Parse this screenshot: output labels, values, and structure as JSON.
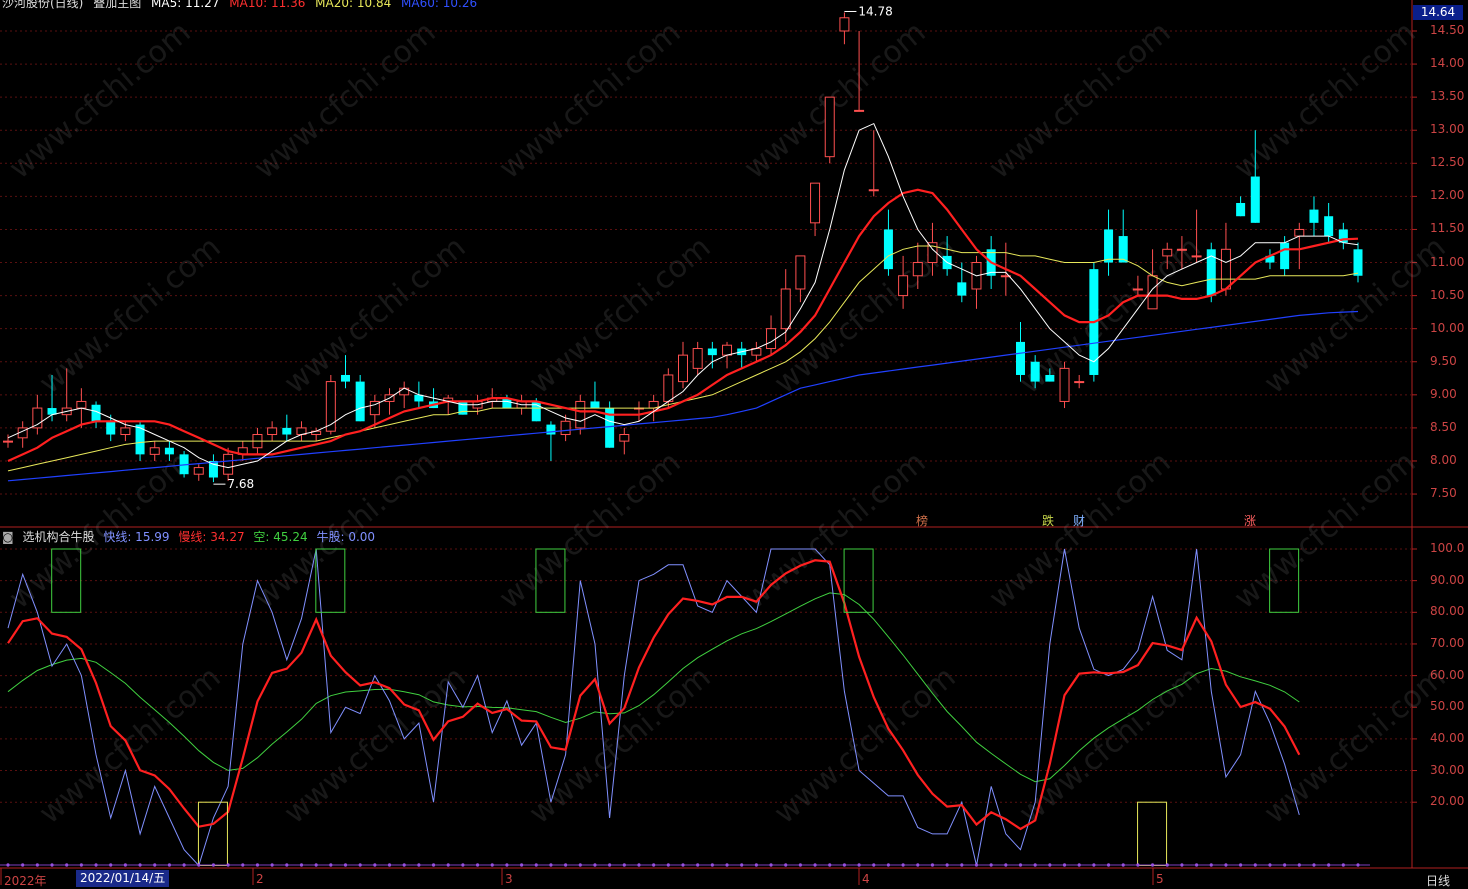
{
  "header": {
    "stock_name": "沙河股份(日线)",
    "indicator": "叠加主图",
    "ma5": "MA5: 11.27",
    "ma10": "MA10: 11.36",
    "ma20": "MA20: 10.84",
    "ma60": "MA60: 10.26"
  },
  "current_price": "14.64",
  "price_axis": [
    "14.50",
    "14.00",
    "13.50",
    "13.00",
    "12.50",
    "12.00",
    "11.50",
    "11.00",
    "10.50",
    "10.00",
    "9.50",
    "9.00",
    "8.50",
    "8.00",
    "7.50"
  ],
  "high_label": "14.78",
  "low_label": "7.68",
  "events": [
    {
      "text": "榜",
      "color": "#d0704a"
    },
    {
      "text": "跌",
      "color": "#c8d84a"
    },
    {
      "text": "财",
      "color": "#7fb0ff"
    },
    {
      "text": "涨",
      "color": "#ff6060"
    }
  ],
  "indicator_panel": {
    "title": "选机构合牛股",
    "fast": "快线: 15.99",
    "slow": "慢线: 34.27",
    "empty": "空: 45.24",
    "bull": "牛股: 0.00",
    "axis": [
      "100.0",
      "90.00",
      "80.00",
      "70.00",
      "60.00",
      "50.00",
      "40.00",
      "30.00",
      "20.00"
    ]
  },
  "time_axis": [
    "2022年",
    "2",
    "3",
    "4",
    "5"
  ],
  "cursor_date": "2022/01/14/五",
  "period": "日线",
  "watermark": "www.cfchi.com",
  "colors": {
    "up": "#ff5050",
    "down": "#00ffff",
    "ma5": "#ffffff",
    "ma10": "#ff2020",
    "ma20": "#e8e85a",
    "ma60": "#2040ff",
    "fast": "#8090ff",
    "slow": "#ff2020",
    "empty": "#40d040"
  },
  "chart_data": {
    "type": "candlestick",
    "candles": [
      [
        8.3,
        8.4,
        8.2,
        8.3
      ],
      [
        8.35,
        8.6,
        8.2,
        8.5
      ],
      [
        8.5,
        9.0,
        8.4,
        8.8
      ],
      [
        8.8,
        9.3,
        8.6,
        8.7
      ],
      [
        8.7,
        9.4,
        8.6,
        8.8
      ],
      [
        8.8,
        9.1,
        8.5,
        8.9
      ],
      [
        8.85,
        8.9,
        8.5,
        8.6
      ],
      [
        8.6,
        8.7,
        8.3,
        8.4
      ],
      [
        8.4,
        8.6,
        8.3,
        8.5
      ],
      [
        8.55,
        8.6,
        8.0,
        8.1
      ],
      [
        8.1,
        8.3,
        8.0,
        8.2
      ],
      [
        8.2,
        8.3,
        8.0,
        8.1
      ],
      [
        8.1,
        8.15,
        7.75,
        7.8
      ],
      [
        7.8,
        7.95,
        7.7,
        7.9
      ],
      [
        8.0,
        8.1,
        7.68,
        7.75
      ],
      [
        7.8,
        8.2,
        7.7,
        8.1
      ],
      [
        8.1,
        8.3,
        8.0,
        8.2
      ],
      [
        8.2,
        8.5,
        8.1,
        8.4
      ],
      [
        8.4,
        8.6,
        8.3,
        8.5
      ],
      [
        8.5,
        8.7,
        8.3,
        8.4
      ],
      [
        8.4,
        8.6,
        8.3,
        8.5
      ],
      [
        8.4,
        8.5,
        8.3,
        8.45
      ],
      [
        8.45,
        9.3,
        8.4,
        9.2
      ],
      [
        9.3,
        9.6,
        9.1,
        9.2
      ],
      [
        9.2,
        9.3,
        8.6,
        8.6
      ],
      [
        8.7,
        9.0,
        8.5,
        8.9
      ],
      [
        8.9,
        9.1,
        8.7,
        9.0
      ],
      [
        9.0,
        9.2,
        8.8,
        9.1
      ],
      [
        9.0,
        9.2,
        8.8,
        8.9
      ],
      [
        8.9,
        9.1,
        8.8,
        8.8
      ],
      [
        8.9,
        9.0,
        8.7,
        8.95
      ],
      [
        8.9,
        8.9,
        8.7,
        8.7
      ],
      [
        8.8,
        9.0,
        8.7,
        8.9
      ],
      [
        8.9,
        9.1,
        8.8,
        8.95
      ],
      [
        8.95,
        9.0,
        8.8,
        8.8
      ],
      [
        8.8,
        9.0,
        8.7,
        8.9
      ],
      [
        8.9,
        8.95,
        8.6,
        8.6
      ],
      [
        8.55,
        8.6,
        8.0,
        8.4
      ],
      [
        8.4,
        8.7,
        8.3,
        8.6
      ],
      [
        8.5,
        9.0,
        8.4,
        8.9
      ],
      [
        8.9,
        9.2,
        8.8,
        8.8
      ],
      [
        8.8,
        8.9,
        8.2,
        8.2
      ],
      [
        8.3,
        8.5,
        8.1,
        8.4
      ],
      [
        8.8,
        8.9,
        8.6,
        8.8
      ],
      [
        8.8,
        9.0,
        8.6,
        8.9
      ],
      [
        8.9,
        9.4,
        8.8,
        9.3
      ],
      [
        9.2,
        9.8,
        9.1,
        9.6
      ],
      [
        9.4,
        9.8,
        9.3,
        9.7
      ],
      [
        9.7,
        9.8,
        9.4,
        9.6
      ],
      [
        9.6,
        9.8,
        9.4,
        9.75
      ],
      [
        9.7,
        9.8,
        9.4,
        9.6
      ],
      [
        9.6,
        9.8,
        9.5,
        9.7
      ],
      [
        9.7,
        10.2,
        9.6,
        10.0
      ],
      [
        10.0,
        10.9,
        9.8,
        10.6
      ],
      [
        10.6,
        11.1,
        10.4,
        11.1
      ],
      [
        11.6,
        12.2,
        11.4,
        12.2
      ],
      [
        12.6,
        13.5,
        12.5,
        13.5
      ],
      [
        14.5,
        14.78,
        14.3,
        14.7
      ],
      [
        13.3,
        14.5,
        13.3,
        13.3
      ],
      [
        12.1,
        13.0,
        12.0,
        12.1
      ],
      [
        11.5,
        11.8,
        10.8,
        10.9
      ],
      [
        10.5,
        11.1,
        10.3,
        10.8
      ],
      [
        10.8,
        11.3,
        10.6,
        11.0
      ],
      [
        11.0,
        11.6,
        10.8,
        11.3
      ],
      [
        11.1,
        11.4,
        10.8,
        10.9
      ],
      [
        10.7,
        11.0,
        10.4,
        10.5
      ],
      [
        10.6,
        11.1,
        10.3,
        11.0
      ],
      [
        11.2,
        11.4,
        10.6,
        10.8
      ],
      [
        10.8,
        11.3,
        10.5,
        10.8
      ],
      [
        9.8,
        10.1,
        9.2,
        9.3
      ],
      [
        9.5,
        9.6,
        9.1,
        9.2
      ],
      [
        9.3,
        9.4,
        9.2,
        9.2
      ],
      [
        8.9,
        9.5,
        8.8,
        9.4
      ],
      [
        9.2,
        9.3,
        9.1,
        9.2
      ],
      [
        10.9,
        11.0,
        9.2,
        9.3
      ],
      [
        11.5,
        11.8,
        10.8,
        11.0
      ],
      [
        11.4,
        11.8,
        11.0,
        11.0
      ],
      [
        10.6,
        10.8,
        10.5,
        10.6
      ],
      [
        10.3,
        11.2,
        10.3,
        10.8
      ],
      [
        11.1,
        11.3,
        10.9,
        11.2
      ],
      [
        11.2,
        11.4,
        10.9,
        11.2
      ],
      [
        11.1,
        11.8,
        11.0,
        11.1
      ],
      [
        11.2,
        11.3,
        10.4,
        10.5
      ],
      [
        10.6,
        11.6,
        10.5,
        11.2
      ],
      [
        11.9,
        12.0,
        11.7,
        11.7
      ],
      [
        12.3,
        13.0,
        11.6,
        11.6
      ],
      [
        11.1,
        11.2,
        10.9,
        11.0
      ],
      [
        11.3,
        11.4,
        10.8,
        10.9
      ],
      [
        11.4,
        11.6,
        10.9,
        11.5
      ],
      [
        11.8,
        12.0,
        11.4,
        11.6
      ],
      [
        11.7,
        11.9,
        11.3,
        11.4
      ],
      [
        11.5,
        11.6,
        11.2,
        11.3
      ],
      [
        11.2,
        11.3,
        10.7,
        10.8
      ]
    ],
    "ma5": [
      8.35,
      8.45,
      8.55,
      8.7,
      8.75,
      8.8,
      8.75,
      8.65,
      8.55,
      8.5,
      8.4,
      8.3,
      8.2,
      8.05,
      7.95,
      7.9,
      7.95,
      8.0,
      8.15,
      8.3,
      8.4,
      8.45,
      8.55,
      8.7,
      8.8,
      8.85,
      8.95,
      9.1,
      9.0,
      8.95,
      8.9,
      8.85,
      8.85,
      8.9,
      8.9,
      8.85,
      8.85,
      8.75,
      8.65,
      8.6,
      8.7,
      8.6,
      8.55,
      8.6,
      8.75,
      8.9,
      9.05,
      9.3,
      9.5,
      9.6,
      9.65,
      9.7,
      9.8,
      9.95,
      10.3,
      10.7,
      11.5,
      12.4,
      13.0,
      13.1,
      12.6,
      12.0,
      11.5,
      11.2,
      11.0,
      10.9,
      10.8,
      10.85,
      10.85,
      10.6,
      10.3,
      10.0,
      9.8,
      9.6,
      9.5,
      9.7,
      10.0,
      10.3,
      10.6,
      10.8,
      10.9,
      11.0,
      11.1,
      11.0,
      11.1,
      11.3,
      11.3,
      11.3,
      11.4,
      11.4,
      11.4,
      11.3,
      11.27
    ],
    "ma10": [
      8.0,
      8.1,
      8.2,
      8.35,
      8.45,
      8.55,
      8.6,
      8.6,
      8.6,
      8.6,
      8.6,
      8.55,
      8.45,
      8.35,
      8.25,
      8.15,
      8.1,
      8.1,
      8.1,
      8.15,
      8.2,
      8.25,
      8.3,
      8.4,
      8.45,
      8.55,
      8.65,
      8.75,
      8.8,
      8.85,
      8.9,
      8.9,
      8.9,
      8.95,
      8.95,
      8.9,
      8.9,
      8.85,
      8.8,
      8.75,
      8.75,
      8.7,
      8.7,
      8.7,
      8.75,
      8.8,
      8.9,
      9.0,
      9.15,
      9.3,
      9.4,
      9.5,
      9.6,
      9.75,
      9.95,
      10.2,
      10.6,
      11.0,
      11.4,
      11.7,
      11.9,
      12.05,
      12.1,
      12.05,
      11.8,
      11.5,
      11.2,
      11.0,
      10.9,
      10.8,
      10.6,
      10.4,
      10.2,
      10.1,
      10.1,
      10.2,
      10.4,
      10.5,
      10.5,
      10.5,
      10.45,
      10.45,
      10.5,
      10.6,
      10.8,
      11.0,
      11.1,
      11.2,
      11.2,
      11.25,
      11.3,
      11.35,
      11.36
    ],
    "ma20": [
      7.85,
      7.9,
      7.95,
      8.0,
      8.05,
      8.1,
      8.15,
      8.2,
      8.25,
      8.28,
      8.3,
      8.3,
      8.3,
      8.3,
      8.3,
      8.3,
      8.3,
      8.3,
      8.3,
      8.3,
      8.3,
      8.3,
      8.35,
      8.4,
      8.45,
      8.5,
      8.55,
      8.6,
      8.65,
      8.7,
      8.7,
      8.75,
      8.75,
      8.8,
      8.8,
      8.8,
      8.8,
      8.8,
      8.8,
      8.8,
      8.8,
      8.8,
      8.8,
      8.8,
      8.8,
      8.85,
      8.9,
      8.95,
      9.0,
      9.1,
      9.2,
      9.3,
      9.4,
      9.5,
      9.65,
      9.85,
      10.1,
      10.4,
      10.7,
      10.9,
      11.1,
      11.2,
      11.25,
      11.25,
      11.2,
      11.15,
      11.15,
      11.15,
      11.15,
      11.1,
      11.1,
      11.05,
      11.0,
      11.0,
      11.0,
      11.05,
      11.05,
      10.95,
      10.8,
      10.7,
      10.65,
      10.7,
      10.75,
      10.75,
      10.75,
      10.75,
      10.8,
      10.8,
      10.8,
      10.8,
      10.8,
      10.8,
      10.84
    ],
    "ma60": [
      7.7,
      7.72,
      7.74,
      7.76,
      7.78,
      7.8,
      7.82,
      7.84,
      7.86,
      7.88,
      7.9,
      7.92,
      7.94,
      7.96,
      7.98,
      8.0,
      8.02,
      8.04,
      8.06,
      8.08,
      8.1,
      8.12,
      8.14,
      8.16,
      8.18,
      8.2,
      8.22,
      8.24,
      8.26,
      8.28,
      8.3,
      8.32,
      8.34,
      8.36,
      8.38,
      8.4,
      8.42,
      8.44,
      8.46,
      8.48,
      8.5,
      8.52,
      8.54,
      8.56,
      8.58,
      8.6,
      8.62,
      8.64,
      8.66,
      8.7,
      8.75,
      8.8,
      8.9,
      9.0,
      9.1,
      9.15,
      9.2,
      9.25,
      9.3,
      9.33,
      9.36,
      9.39,
      9.42,
      9.45,
      9.48,
      9.51,
      9.54,
      9.57,
      9.6,
      9.63,
      9.66,
      9.69,
      9.72,
      9.75,
      9.78,
      9.81,
      9.84,
      9.87,
      9.9,
      9.93,
      9.96,
      9.99,
      10.02,
      10.05,
      10.08,
      10.11,
      10.14,
      10.17,
      10.2,
      10.22,
      10.24,
      10.25,
      10.26
    ],
    "fast": [
      75,
      92,
      80,
      63,
      70,
      60,
      35,
      15,
      30,
      10,
      25,
      15,
      5,
      0,
      15,
      25,
      70,
      90,
      80,
      65,
      78,
      100,
      42,
      50,
      48,
      60,
      52,
      40,
      45,
      20,
      58,
      50,
      60,
      42,
      52,
      38,
      45,
      20,
      35,
      90,
      70,
      15,
      60,
      90,
      92,
      95,
      95,
      82,
      80,
      90,
      85,
      80,
      100,
      100,
      100,
      100,
      95,
      55,
      30,
      26,
      22,
      22,
      12,
      10,
      10,
      20,
      0,
      25,
      10,
      5,
      20,
      70,
      100,
      75,
      62,
      60,
      62,
      68,
      85,
      68,
      65,
      100,
      55,
      28,
      35,
      55,
      45,
      32,
      16
    ]
  }
}
